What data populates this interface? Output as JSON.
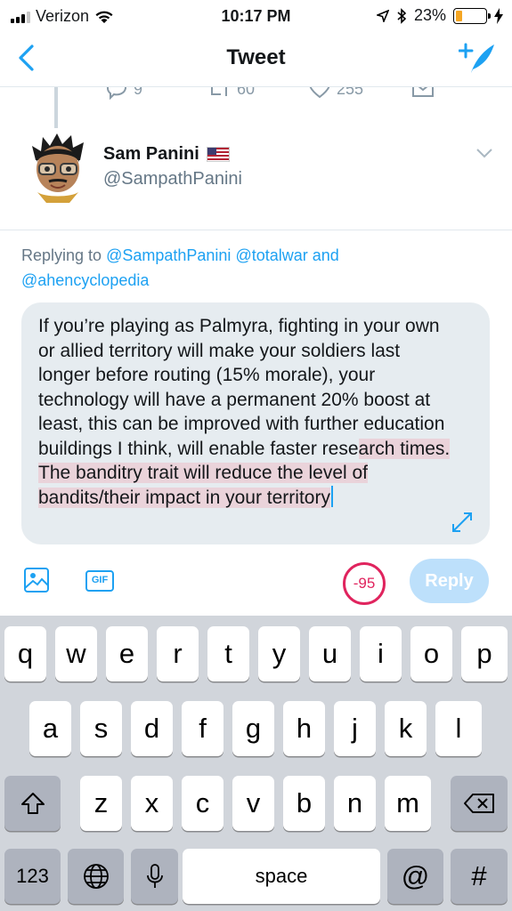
{
  "status_bar": {
    "carrier": "Verizon",
    "time": "10:17 PM",
    "battery": "23%",
    "battery_level": 0.23
  },
  "nav": {
    "title": "Tweet",
    "back_icon": "chevron-left-icon",
    "compose_icon": "compose-tweet-icon"
  },
  "previous_tweet_actions": {
    "replies": "9",
    "retweets": "60",
    "likes": "255"
  },
  "quoted_user": {
    "name": "Sam Panini",
    "handle": "@SampathPanini"
  },
  "replying_to": {
    "prefix": "Replying to",
    "mention_1": "@SampathPanini",
    "mention_2": "@totalwar",
    "conjunction": "and",
    "mention_3": "@ahencyclopedia"
  },
  "compose": {
    "text_before_highlight": "If you’re playing as Palmyra, fighting in your own or allied territory will make your soldiers last longer before routing (15% morale), your technology will have a permanent 20% boost at least, this can be improved with further education buildings I think, will enable faster rese",
    "text_highlight": "arch times. The banditry trait will reduce the level of bandits/their impact in your territory"
  },
  "toolbar": {
    "gif_label": "GIF",
    "char_counter": "-95",
    "reply_label": "Reply"
  },
  "keyboard": {
    "row1": [
      "q",
      "w",
      "e",
      "r",
      "t",
      "y",
      "u",
      "i",
      "o",
      "p"
    ],
    "row2": [
      "a",
      "s",
      "d",
      "f",
      "g",
      "h",
      "j",
      "k",
      "l"
    ],
    "row3": [
      "z",
      "x",
      "c",
      "v",
      "b",
      "n",
      "m"
    ],
    "numbers_label": "123",
    "space_label": "space",
    "at_label": "@",
    "hash_label": "#"
  },
  "colors": {
    "accent": "#1da1f2",
    "counter_over": "#e0245e",
    "highlight": "#ead3da"
  }
}
